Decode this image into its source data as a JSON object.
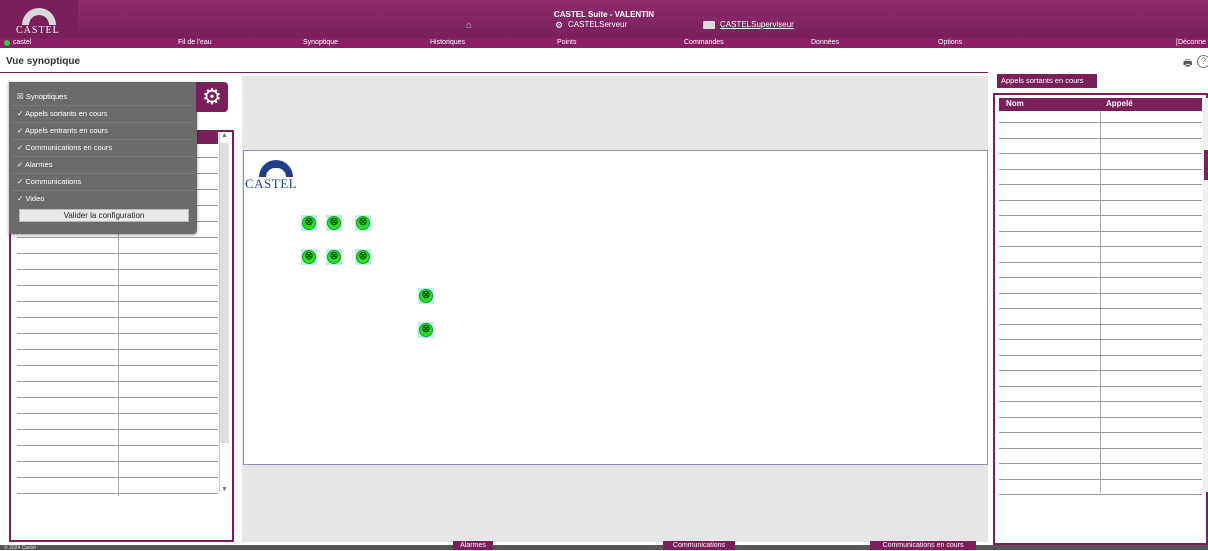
{
  "header": {
    "app_title": "CASTEL Suite - VALENTIN",
    "logo_text": "CASTEL",
    "server_label": "CASTELServeur",
    "supervisor_label": "CASTELSuperviseur"
  },
  "menu": {
    "user": "castel",
    "items": [
      "Fil de l'eau",
      "Synoptique",
      "Historiques",
      "Points",
      "Commandes",
      "Données",
      "Options"
    ],
    "logout": "[Déconne"
  },
  "page": {
    "title": "Vue synoptique"
  },
  "canvas": {
    "logo_text": "CASTEL",
    "points_count": 8
  },
  "config_menu": {
    "items": [
      {
        "label": "Synoptiques",
        "mark": "☒"
      },
      {
        "label": "Appels sortants en cours",
        "mark": "✓"
      },
      {
        "label": "Appels entrants en cours",
        "mark": "✓"
      },
      {
        "label": "Communications en cours",
        "mark": "✓"
      },
      {
        "label": "Alarmes",
        "mark": "✓"
      },
      {
        "label": "Communications",
        "mark": "✓"
      },
      {
        "label": "Video",
        "mark": "✓"
      }
    ],
    "validate_label": "Valider la configuration"
  },
  "right_panel": {
    "tab_label": "Appels sortants en cours",
    "col_name": "Nom",
    "col_called": "Appelé"
  },
  "footer": {
    "copyright": "© 2024 Castel",
    "tabs": [
      "Alarmes",
      "Communications",
      "Communications en cours"
    ]
  },
  "colors": {
    "brand": "#7a1f5c",
    "point": "#28e028"
  }
}
